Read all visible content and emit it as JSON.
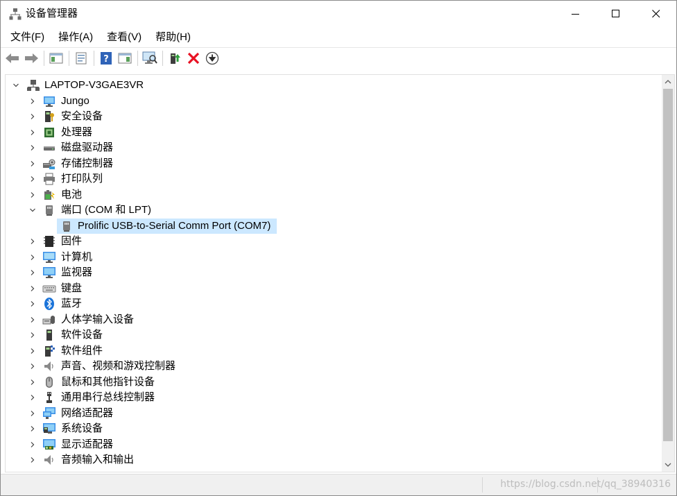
{
  "window": {
    "title": "设备管理器",
    "icon": "device-manager-icon",
    "controls": {
      "minimize": "minimize-icon",
      "maximize": "maximize-icon",
      "close": "close-icon"
    }
  },
  "menu": {
    "items": [
      {
        "label": "文件(F)"
      },
      {
        "label": "操作(A)"
      },
      {
        "label": "查看(V)"
      },
      {
        "label": "帮助(H)"
      }
    ]
  },
  "toolbar": {
    "buttons": [
      "back-icon",
      "forward-icon",
      "show-hide-tree-icon",
      "properties-icon",
      "help-icon",
      "action-pane-icon",
      "scan-hardware-icon",
      "update-driver-icon",
      "uninstall-device-icon",
      "disable-device-icon"
    ]
  },
  "tree": {
    "root": {
      "label": "LAPTOP-V3GAE3VR"
    },
    "categories": [
      {
        "label": "Jungo",
        "icon": "jungo-icon"
      },
      {
        "label": "安全设备",
        "icon": "security-device-icon"
      },
      {
        "label": "处理器",
        "icon": "processor-icon"
      },
      {
        "label": "磁盘驱动器",
        "icon": "disk-drive-icon"
      },
      {
        "label": "存储控制器",
        "icon": "storage-controller-icon"
      },
      {
        "label": "打印队列",
        "icon": "print-queue-icon"
      },
      {
        "label": "电池",
        "icon": "battery-icon"
      },
      {
        "label": "端口 (COM 和 LPT)",
        "icon": "port-icon",
        "expanded": true
      },
      {
        "label": "固件",
        "icon": "firmware-icon"
      },
      {
        "label": "计算机",
        "icon": "computer-icon"
      },
      {
        "label": "监视器",
        "icon": "monitor-icon"
      },
      {
        "label": "键盘",
        "icon": "keyboard-icon"
      },
      {
        "label": "蓝牙",
        "icon": "bluetooth-icon"
      },
      {
        "label": "人体学输入设备",
        "icon": "hid-icon"
      },
      {
        "label": "软件设备",
        "icon": "software-device-icon"
      },
      {
        "label": "软件组件",
        "icon": "software-component-icon"
      },
      {
        "label": "声音、视频和游戏控制器",
        "icon": "sound-icon"
      },
      {
        "label": "鼠标和其他指针设备",
        "icon": "mouse-icon"
      },
      {
        "label": "通用串行总线控制器",
        "icon": "usb-icon"
      },
      {
        "label": "网络适配器",
        "icon": "network-adapter-icon"
      },
      {
        "label": "系统设备",
        "icon": "system-device-icon"
      },
      {
        "label": "显示适配器",
        "icon": "display-adapter-icon"
      },
      {
        "label": "音频输入和输出",
        "icon": "audio-io-icon"
      }
    ],
    "port_child": {
      "label": "Prolific USB-to-Serial Comm Port (COM7)",
      "selected": true
    }
  },
  "watermark": "https://blog.csdn.net/qq_38940316",
  "colors": {
    "selection": "#cce8ff",
    "accent_red": "#e81123",
    "green": "#2e9e3a"
  }
}
